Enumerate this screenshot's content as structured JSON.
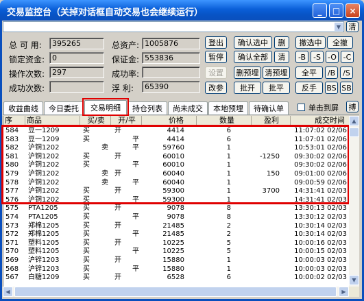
{
  "window": {
    "title": "交易监控台（关掉对话框自动交易也会继续运行）"
  },
  "caption_buttons": {
    "minimize": "_",
    "maximize": "□",
    "close": "×"
  },
  "toolbar": {
    "clear_label": "清"
  },
  "stats": {
    "available_label": "总 可 用:",
    "available_value": "395265",
    "locked_label": "锁定资金:",
    "locked_value": "0",
    "operations_label": "操作次数:",
    "operations_value": "297",
    "success_count_label": "成功次数:",
    "success_count_value": "",
    "total_assets_label": "总资产:",
    "total_assets_value": "1005876",
    "margin_label": "保证金:",
    "margin_value": "553836",
    "success_rate_label": "成功率:",
    "success_rate_value": "",
    "floating_pl_label": "浮  利:",
    "floating_pl_value": "65390"
  },
  "buttons": {
    "login": "登出",
    "pause": "暂停",
    "settings": "设置",
    "modify": "改参",
    "confirm_selected": "确认选中",
    "delete": "删",
    "confirm_all": "确认全部",
    "clear": "清",
    "delete_preorder": "删预埋",
    "clear_preorder": "清预埋",
    "close_open": "批开",
    "close_flat": "批平",
    "cancel_selected": "撤选中",
    "select_all": "全撤",
    "minus_b": "-B",
    "minus_s": "-S",
    "minus_o": "-O",
    "minus_c": "-C",
    "close_all": "全平",
    "b_slash": "/B",
    "s_slash": "/S",
    "reverse": "反手",
    "bs": "BS",
    "sb": "SB"
  },
  "tabs": [
    "收益曲线",
    "今日委托",
    "交易明细",
    "持仓列表",
    "尚未成交",
    "本地预埋",
    "待确认单"
  ],
  "single_screen": {
    "label": "单击到屏",
    "next": "搏"
  },
  "table": {
    "headers": [
      "序",
      "商品",
      "买/卖",
      "开/平",
      "价格",
      "数量",
      "盈利",
      "成交时间"
    ],
    "rows": [
      {
        "seq": "584",
        "product": "豆一1209",
        "side": "买",
        "side_align": "left",
        "oc": "开",
        "oc_align": "left",
        "price": "4414",
        "qty": "6",
        "profit": "",
        "time": "11:07:02 02/06"
      },
      {
        "seq": "583",
        "product": "豆一1209",
        "side": "买",
        "side_align": "left",
        "oc": "平",
        "oc_align": "right",
        "price": "4414",
        "qty": "6",
        "profit": "",
        "time": "11:07:01 02/06"
      },
      {
        "seq": "582",
        "product": "沪铜1202",
        "side": "卖",
        "side_align": "right",
        "oc": "平",
        "oc_align": "right",
        "price": "59760",
        "qty": "1",
        "profit": "",
        "time": "10:53:01 02/06"
      },
      {
        "seq": "581",
        "product": "沪铜1202",
        "side": "买",
        "side_align": "left",
        "oc": "开",
        "oc_align": "left",
        "price": "60010",
        "qty": "1",
        "profit": "-1250",
        "time": "09:30:02 02/06"
      },
      {
        "seq": "580",
        "product": "沪铜1202",
        "side": "买",
        "side_align": "left",
        "oc": "平",
        "oc_align": "right",
        "price": "60010",
        "qty": "1",
        "profit": "",
        "time": "09:30:02 02/06"
      },
      {
        "seq": "579",
        "product": "沪铜1202",
        "side": "卖",
        "side_align": "right",
        "oc": "开",
        "oc_align": "left",
        "price": "60040",
        "qty": "1",
        "profit": "150",
        "time": "09:01:00 02/06"
      },
      {
        "seq": "578",
        "product": "沪铜1202",
        "side": "卖",
        "side_align": "right",
        "oc": "平",
        "oc_align": "right",
        "price": "60040",
        "qty": "1",
        "profit": "",
        "time": "09:00:59 02/06"
      },
      {
        "seq": "577",
        "product": "沪铜1202",
        "side": "买",
        "side_align": "left",
        "oc": "开",
        "oc_align": "left",
        "price": "59300",
        "qty": "1",
        "profit": "3700",
        "time": "14:31:41 02/03"
      },
      {
        "seq": "576",
        "product": "沪铜1202",
        "side": "买",
        "side_align": "left",
        "oc": "平",
        "oc_align": "right",
        "price": "59300",
        "qty": "1",
        "profit": "",
        "time": "14:31:41 02/03"
      },
      {
        "seq": "575",
        "product": "PTA1205",
        "side": "买",
        "side_align": "left",
        "oc": "开",
        "oc_align": "left",
        "price": "9078",
        "qty": "8",
        "profit": "",
        "time": "13:30:13 02/03"
      },
      {
        "seq": "574",
        "product": "PTA1205",
        "side": "买",
        "side_align": "left",
        "oc": "平",
        "oc_align": "right",
        "price": "9078",
        "qty": "8",
        "profit": "",
        "time": "13:30:12 02/03"
      },
      {
        "seq": "573",
        "product": "郑棉1205",
        "side": "买",
        "side_align": "left",
        "oc": "开",
        "oc_align": "left",
        "price": "21485",
        "qty": "2",
        "profit": "",
        "time": "10:30:14 02/03"
      },
      {
        "seq": "572",
        "product": "郑棉1205",
        "side": "买",
        "side_align": "left",
        "oc": "平",
        "oc_align": "right",
        "price": "21485",
        "qty": "2",
        "profit": "",
        "time": "10:30:14 02/03"
      },
      {
        "seq": "571",
        "product": "塑料1205",
        "side": "买",
        "side_align": "left",
        "oc": "开",
        "oc_align": "left",
        "price": "10225",
        "qty": "5",
        "profit": "",
        "time": "10:00:16 02/03"
      },
      {
        "seq": "570",
        "product": "塑料1205",
        "side": "买",
        "side_align": "left",
        "oc": "平",
        "oc_align": "right",
        "price": "10225",
        "qty": "5",
        "profit": "",
        "time": "10:00:15 02/03"
      },
      {
        "seq": "569",
        "product": "沪锌1203",
        "side": "买",
        "side_align": "left",
        "oc": "开",
        "oc_align": "left",
        "price": "15880",
        "qty": "1",
        "profit": "",
        "time": "10:00:03 02/03"
      },
      {
        "seq": "568",
        "product": "沪锌1203",
        "side": "买",
        "side_align": "left",
        "oc": "平",
        "oc_align": "right",
        "price": "15880",
        "qty": "1",
        "profit": "",
        "time": "10:00:03 02/03"
      },
      {
        "seq": "567",
        "product": "白糖1209",
        "side": "买",
        "side_align": "left",
        "oc": "开",
        "oc_align": "left",
        "price": "6528",
        "qty": "6",
        "profit": "",
        "time": "10:00:02 02/03"
      }
    ]
  },
  "colors": {
    "highlight": "#e00000",
    "title_bar": "#0a5fd8"
  }
}
